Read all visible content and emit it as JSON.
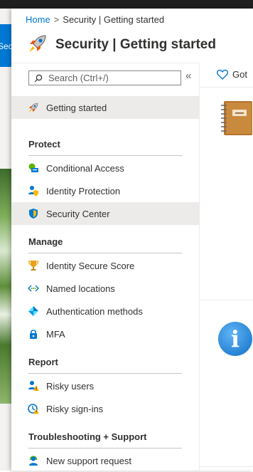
{
  "background": {
    "left_label": "Secur"
  },
  "breadcrumb": {
    "home": "Home",
    "separator": ">",
    "current": "Security | Getting started"
  },
  "header": {
    "title": "Security | Getting started",
    "icon": "rocket-icon"
  },
  "search": {
    "placeholder": "Search (Ctrl+/)",
    "collapse_glyph": "«"
  },
  "nav": {
    "getting_started": "Getting started",
    "sections": [
      {
        "label": "Protect",
        "items": [
          "Conditional Access",
          "Identity Protection",
          "Security Center"
        ]
      },
      {
        "label": "Manage",
        "items": [
          "Identity Secure Score",
          "Named locations",
          "Authentication methods",
          "MFA"
        ]
      },
      {
        "label": "Report",
        "items": [
          "Risky users",
          "Risky sign-ins"
        ]
      },
      {
        "label": "Troubleshooting + Support",
        "items": [
          "New support request"
        ]
      }
    ]
  },
  "content": {
    "feedback_label": "Got",
    "info_glyph": "i"
  },
  "colors": {
    "accent": "#0078d4",
    "selected_bg": "#edebe9",
    "topbar": "#1f1f1f"
  }
}
